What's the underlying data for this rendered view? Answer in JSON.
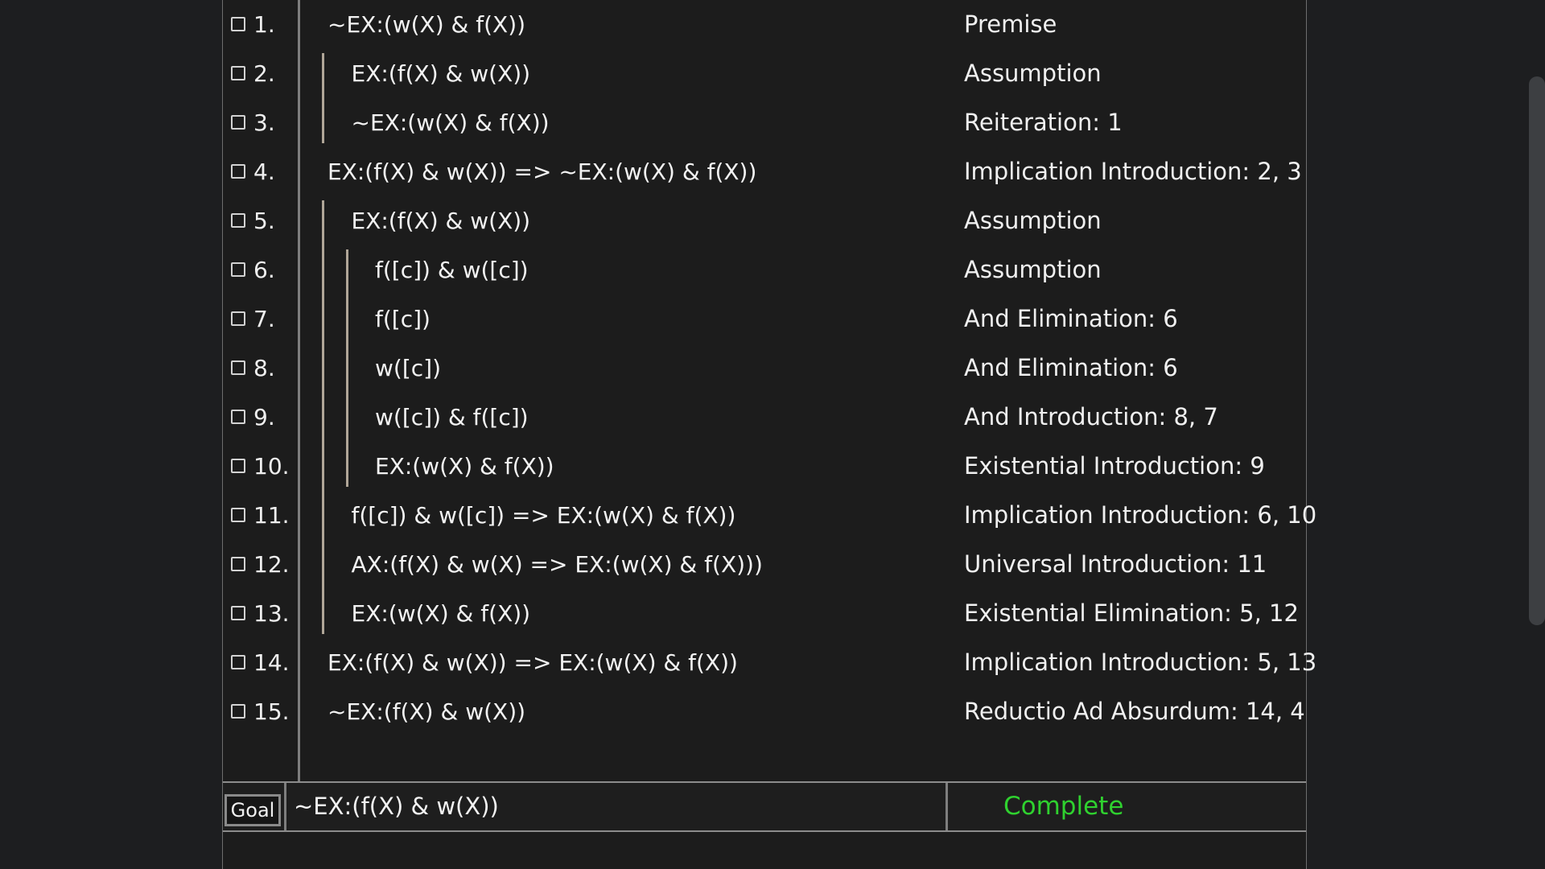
{
  "proof": {
    "lines": [
      {
        "number": "1.",
        "formula": "~EX:(w(X) & f(X))",
        "justification": "Premise",
        "depth": 0
      },
      {
        "number": "2.",
        "formula": "EX:(f(X) & w(X))",
        "justification": "Assumption",
        "depth": 1
      },
      {
        "number": "3.",
        "formula": "~EX:(w(X) & f(X))",
        "justification": "Reiteration: 1",
        "depth": 1
      },
      {
        "number": "4.",
        "formula": "EX:(f(X) & w(X)) => ~EX:(w(X) & f(X))",
        "justification": "Implication Introduction: 2, 3",
        "depth": 0
      },
      {
        "number": "5.",
        "formula": "EX:(f(X) & w(X))",
        "justification": "Assumption",
        "depth": 1
      },
      {
        "number": "6.",
        "formula": "f([c]) & w([c])",
        "justification": "Assumption",
        "depth": 2
      },
      {
        "number": "7.",
        "formula": "f([c])",
        "justification": "And Elimination: 6",
        "depth": 2
      },
      {
        "number": "8.",
        "formula": "w([c])",
        "justification": "And Elimination: 6",
        "depth": 2
      },
      {
        "number": "9.",
        "formula": "w([c]) & f([c])",
        "justification": "And Introduction: 8, 7",
        "depth": 2
      },
      {
        "number": "10.",
        "formula": "EX:(w(X) & f(X))",
        "justification": "Existential Introduction: 9",
        "depth": 2
      },
      {
        "number": "11.",
        "formula": "f([c]) & w([c]) => EX:(w(X) & f(X))",
        "justification": "Implication Introduction: 6, 10",
        "depth": 1
      },
      {
        "number": "12.",
        "formula": "AX:(f(X) & w(X) => EX:(w(X) & f(X)))",
        "justification": "Universal Introduction: 11",
        "depth": 1
      },
      {
        "number": "13.",
        "formula": "EX:(w(X) & f(X))",
        "justification": "Existential Elimination: 5, 12",
        "depth": 1
      },
      {
        "number": "14.",
        "formula": "EX:(f(X) & w(X)) => EX:(w(X) & f(X))",
        "justification": "Implication Introduction: 5, 13",
        "depth": 0
      },
      {
        "number": "15.",
        "formula": "~EX:(f(X) & w(X))",
        "justification": "Reductio Ad Absurdum: 14, 4",
        "depth": 0
      }
    ]
  },
  "goal": {
    "button_label": "Goal",
    "formula": "~EX:(f(X) & w(X))",
    "status": "Complete",
    "status_color": "#2fd12f"
  },
  "theme": {
    "background": "#1c1c1c",
    "subproof_bar": "#b0a698"
  }
}
